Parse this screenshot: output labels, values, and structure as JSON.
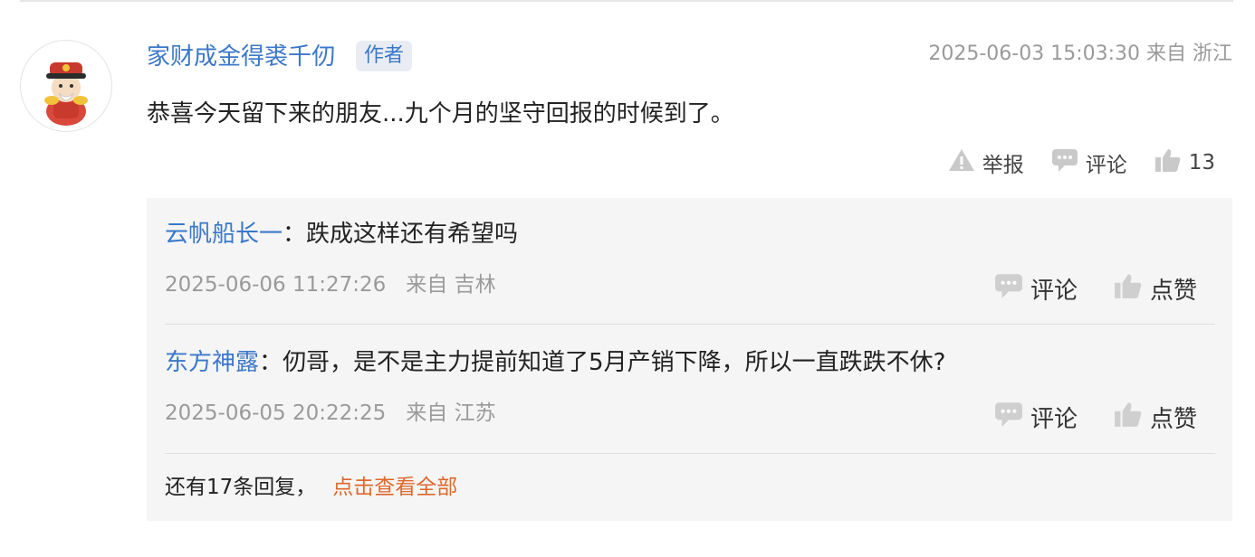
{
  "comment": {
    "author": "家财成金得裘千仞",
    "badge": "作者",
    "time": "2025-06-03 15:03:30 来自 浙江",
    "text": "恭喜今天留下来的朋友...九个月的坚守回报的时候到了。",
    "actions": {
      "report": "举报",
      "comment": "评论",
      "like_count": "13"
    }
  },
  "replies": [
    {
      "user": "云帆船长一",
      "colon": "：",
      "text": "跌成这样还有希望吗",
      "time": "2025-06-06 11:27:26",
      "location": "来自 吉林",
      "comment_label": "评论",
      "like_label": "点赞"
    },
    {
      "user": "东方神露",
      "colon": "：",
      "text": "仞哥，是不是主力提前知道了5月产销下降，所以一直跌跌不休?",
      "time": "2025-06-05 20:22:25",
      "location": "来自 江苏",
      "comment_label": "评论",
      "like_label": "点赞"
    }
  ],
  "more": {
    "count_text": "还有17条回复，",
    "link_text": "点击查看全部"
  },
  "colors": {
    "link_blue": "#3b78c9",
    "accent_orange": "#e0672c",
    "muted": "#9a9a9a",
    "panel_bg": "#f5f5f5"
  }
}
